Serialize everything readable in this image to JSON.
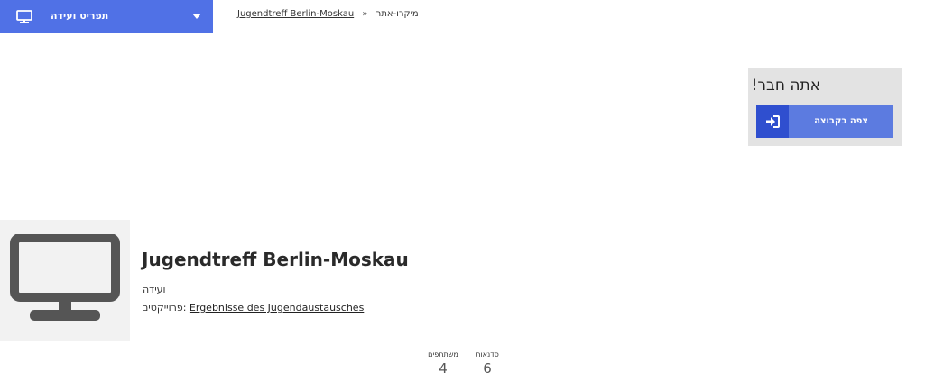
{
  "menu": {
    "label": "תפריט ועידה",
    "icon": "monitor-icon",
    "caret_icon": "caret-down-icon",
    "color": "#5071e6"
  },
  "breadcrumb": {
    "root": "מיקרו-אתר",
    "separator": "»",
    "current": "Jugendtreff Berlin-Moskau"
  },
  "join_card": {
    "title": "אתה חבר!",
    "button_label": "צפה בקבוצה",
    "button_icon": "sign-in-icon",
    "button_color": "#5c7be0",
    "icon_bg_color": "#2f4fcf"
  },
  "group": {
    "image_icon": "monitor-icon",
    "title": "Jugendtreff Berlin-Moskau",
    "type": "ועידה",
    "projects_label": "פרוייקטים:",
    "projects_link": "Ergebnisse des Jugendaustausches"
  },
  "stats": {
    "participants_label": "משתתפים",
    "participants_value": "4",
    "workshops_label": "סדנאות",
    "workshops_value": "6"
  }
}
